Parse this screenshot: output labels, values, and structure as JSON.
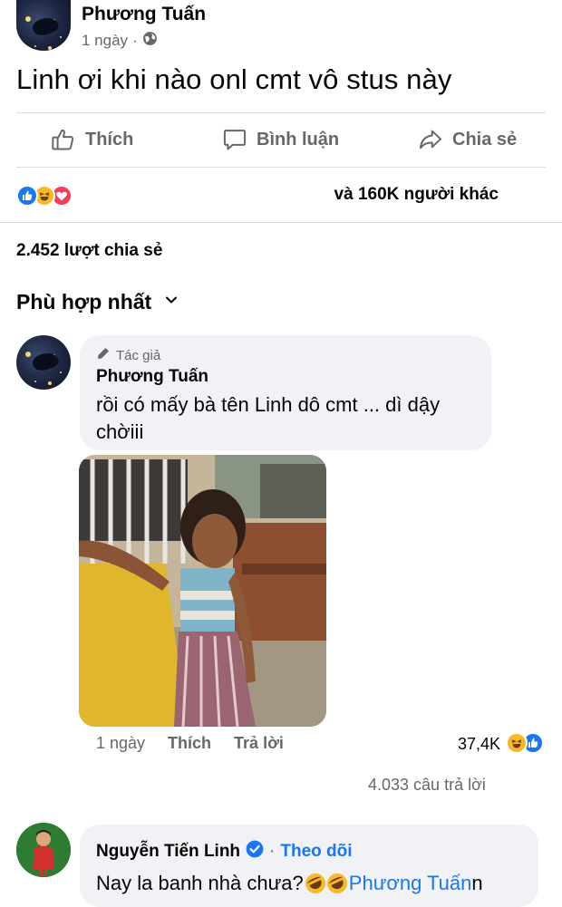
{
  "post": {
    "author": "Phương Tuấn",
    "time": "1 ngày",
    "dot": "·",
    "privacy_icon": "globe-icon",
    "text": "Linh ơi khi nào onl cmt vô stus này"
  },
  "actions": {
    "like": "Thích",
    "comment": "Bình luận",
    "share": "Chia sẻ"
  },
  "reactions": {
    "icons": [
      "like-reaction-icon",
      "haha-reaction-icon",
      "love-reaction-icon"
    ],
    "summary": "và 160K người khác"
  },
  "shares": "2.452 lượt chia sẻ",
  "sort": {
    "label": "Phù hợp nhất",
    "icon": "chevron-down-icon"
  },
  "comments": [
    {
      "badge": "Tác giả",
      "author": "Phương Tuấn",
      "text": "rồi có mấy bà tên Linh dô cmt ... dì dậy chờiii",
      "time": "1 ngày",
      "like": "Thích",
      "reply": "Trả lời",
      "reaction_count": "37,4K",
      "replies": "4.033 câu trả lời"
    },
    {
      "author": "Nguyễn Tiến Linh",
      "dot": "·",
      "follow": "Theo dõi",
      "text": "Nay la banh nhà chưa?",
      "mention": "Phương Tuấn",
      "trailing": "n"
    }
  ],
  "colors": {
    "primary_text": "#050505",
    "secondary_text": "#65676b",
    "link_blue": "#1877f2",
    "bubble_bg": "#f0f2f5",
    "divider": "#dadde1"
  }
}
